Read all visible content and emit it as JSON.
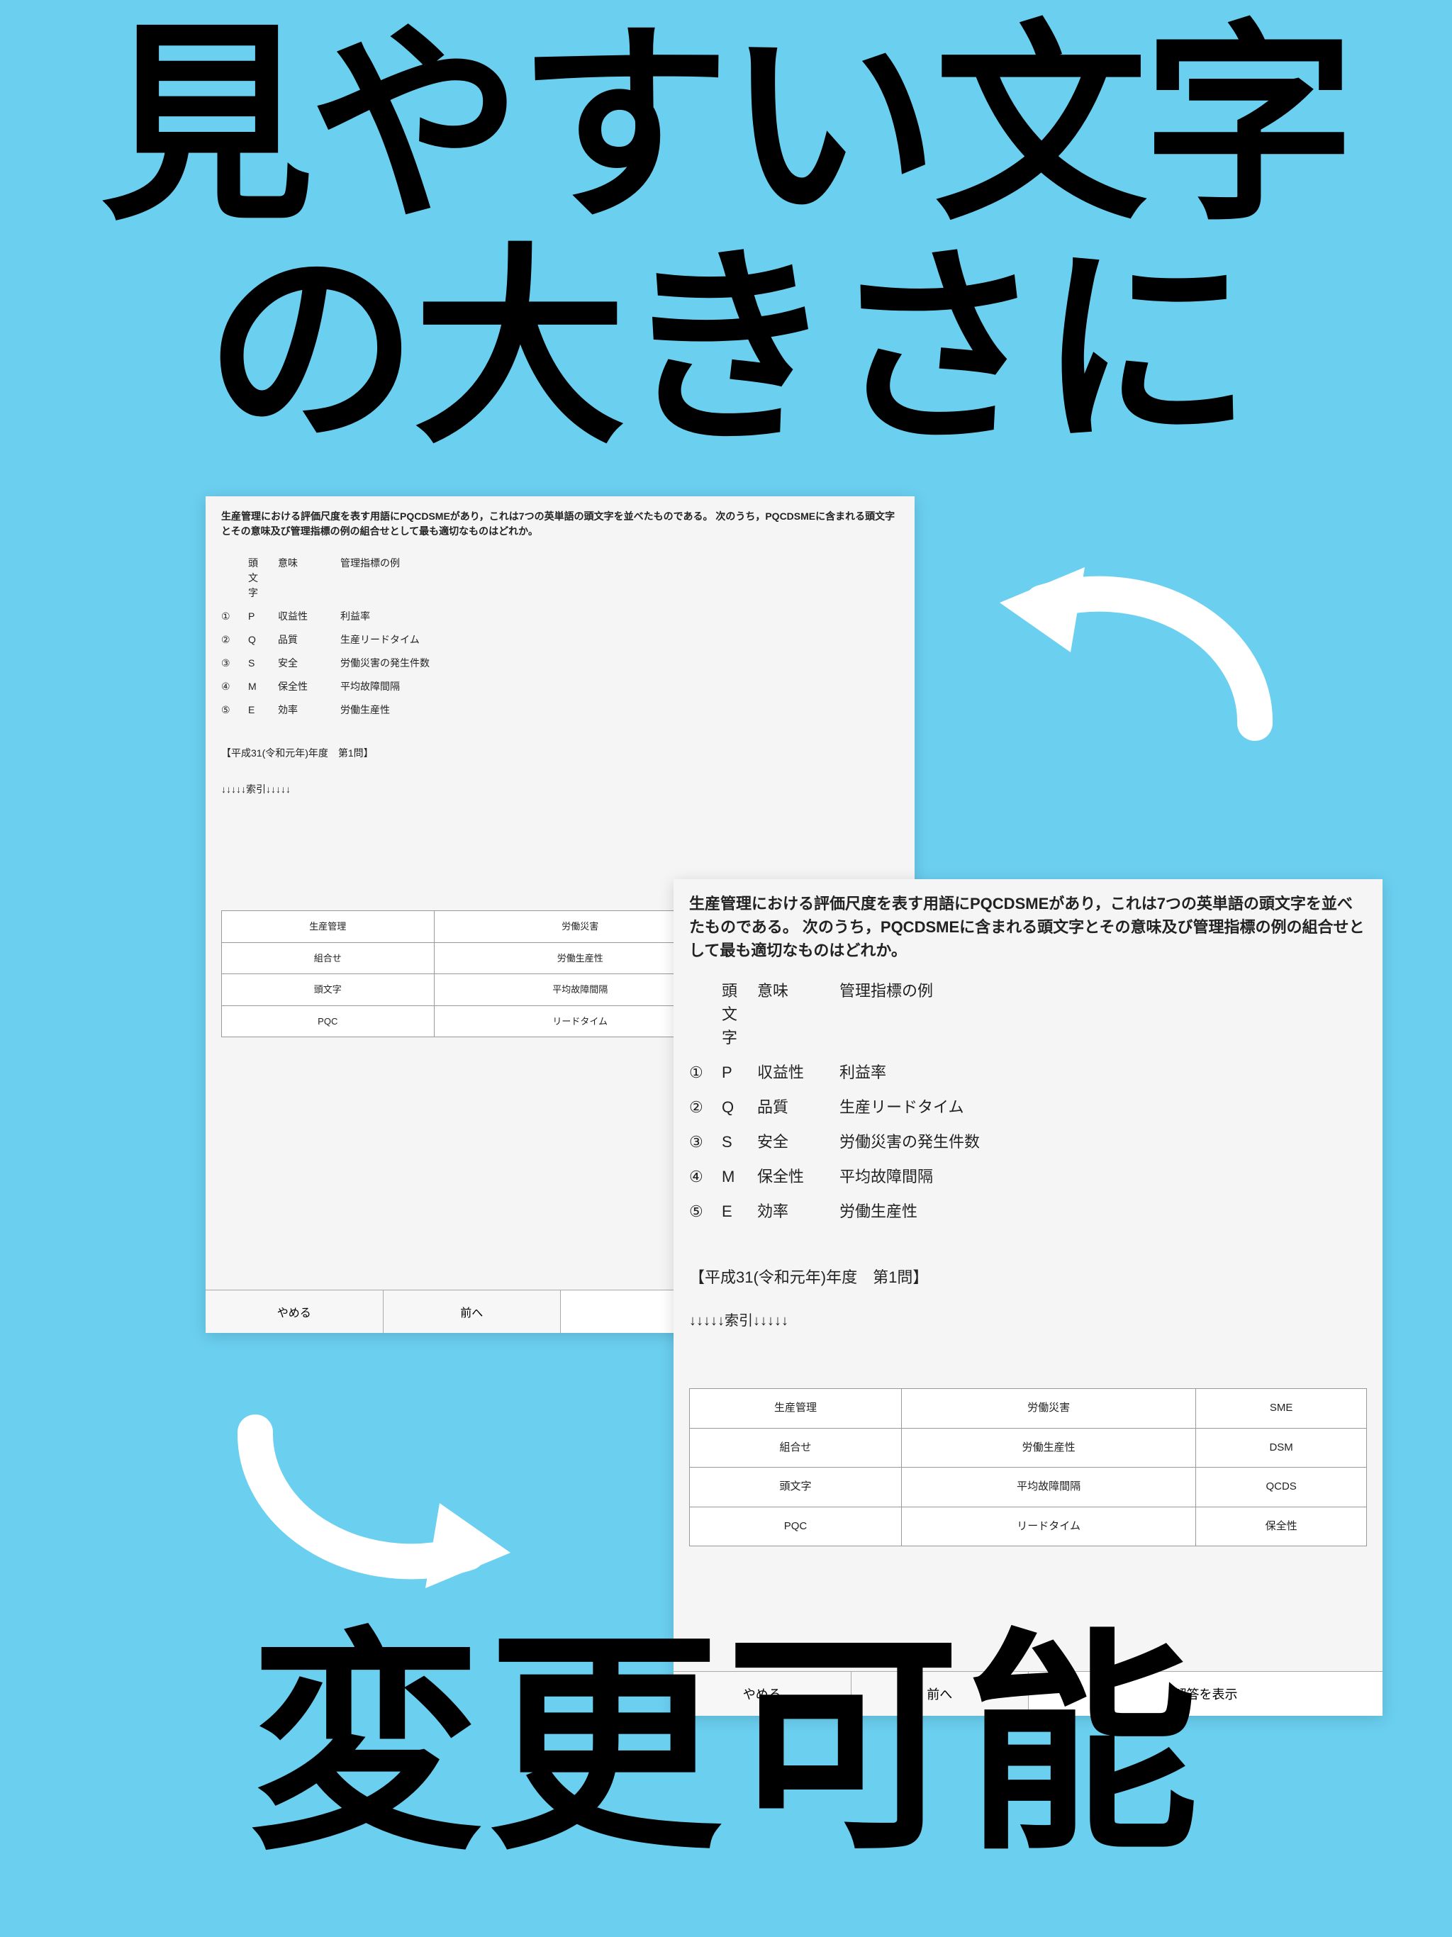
{
  "headline": {
    "line1": "見やすい文字",
    "line2": "の大きさに",
    "bottom": "変更可能"
  },
  "question_text": "生産管理における評価尺度を表す用語にPQCDSMEがあり，これは7つの英単語の頭文字を並べたものである。 次のうち，PQCDSMEに含まれる頭文字とその意味及び管理指標の例の組合せとして最も適切なものはどれか。",
  "header": {
    "initial": "頭文字",
    "meaning": "意味",
    "example": "管理指標の例"
  },
  "options": [
    {
      "n": "①",
      "letter": "P",
      "meaning": "収益性",
      "example": "利益率"
    },
    {
      "n": "②",
      "letter": "Q",
      "meaning": "品質",
      "example": "生産リードタイム"
    },
    {
      "n": "③",
      "letter": "S",
      "meaning": "安全",
      "example": "労働災害の発生件数"
    },
    {
      "n": "④",
      "letter": "M",
      "meaning": "保全性",
      "example": "平均故障間隔"
    },
    {
      "n": "⑤",
      "letter": "E",
      "meaning": "効率",
      "example": "労働生産性"
    }
  ],
  "exam_meta": "【平成31(令和元年)年度　第1問】",
  "index_label": "↓↓↓↓↓索引↓↓↓↓↓",
  "keywords": [
    [
      "生産管理",
      "労働災害",
      "SME"
    ],
    [
      "組合せ",
      "労働生産性",
      "DSM"
    ],
    [
      "頭文字",
      "平均故障間隔",
      "QCDS"
    ],
    [
      "PQC",
      "リードタイム",
      "保全性"
    ]
  ],
  "footer": {
    "quit": "やめる",
    "prev": "前へ",
    "answer": "解答を表示"
  }
}
